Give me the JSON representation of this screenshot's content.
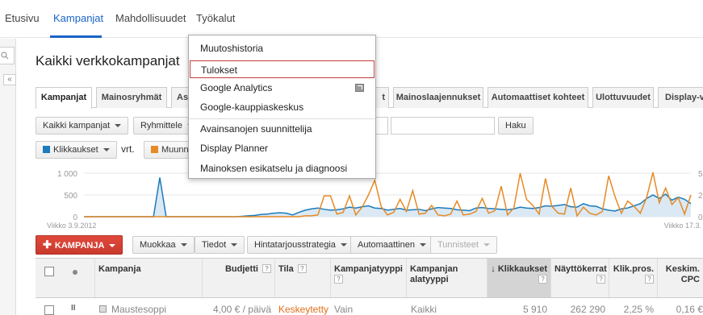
{
  "topnav": {
    "items": [
      "Etusivu",
      "Kampanjat",
      "Mahdollisuudet",
      "Työkalut"
    ]
  },
  "sidebar": {
    "collapse_glyph": "«"
  },
  "page": {
    "title": "Kaikki verkkokampanjat"
  },
  "tabs": [
    "Kampanjat",
    "Mainosryhmät",
    "As",
    "t",
    "Mainoslaajennukset",
    "Automaattiset kohteet",
    "Ulottuvuudet",
    "Display-ve"
  ],
  "filters": {
    "all_campaigns": "Kaikki kampanjat",
    "segment": "Ryhmittele",
    "search_button": "Haku"
  },
  "metrics": {
    "metric1": "Klikkaukset",
    "metric1_color": "#1a7bbd",
    "vs": "vrt.",
    "metric2": "Muunn",
    "metric2_color": "#e68a25"
  },
  "chart": {
    "y_left": [
      "1 000",
      "500",
      "0"
    ],
    "y_right": [
      "5",
      "2",
      "0"
    ],
    "date_start": "Viikko 3.9.2012",
    "date_end": "Viikko 17.3."
  },
  "chart_data": {
    "type": "line",
    "series": [
      {
        "name": "Klikkaukset",
        "values": [
          0,
          0,
          0,
          0,
          0,
          0,
          0,
          0,
          0,
          0,
          0,
          0,
          900,
          0,
          0,
          0,
          0,
          0,
          0,
          0,
          0,
          0,
          0,
          0,
          0,
          10,
          20,
          30,
          50,
          60,
          80,
          90,
          80,
          40,
          100,
          150,
          180,
          200,
          170,
          150,
          160,
          180,
          220,
          200,
          230,
          250,
          200,
          190,
          150,
          170,
          190,
          150,
          160,
          170,
          140,
          180,
          210,
          200,
          190,
          160,
          150,
          140,
          200,
          210,
          190,
          180,
          170,
          160,
          180,
          220,
          200,
          190,
          210,
          250,
          240,
          260,
          280,
          230,
          220,
          300,
          250,
          240,
          180,
          150,
          130,
          180,
          200,
          250,
          300,
          420,
          500,
          420,
          520,
          380,
          450,
          400,
          300
        ]
      },
      {
        "name": "Muunn",
        "values": [
          0,
          0,
          0,
          0,
          0,
          0,
          0,
          0,
          0,
          0,
          0,
          0,
          0,
          0,
          0,
          0,
          0,
          0,
          0,
          0,
          0,
          0,
          0,
          0,
          0,
          0,
          0,
          0,
          0,
          0,
          0,
          0,
          0,
          0,
          0,
          0.1,
          0.1,
          0.2,
          2.4,
          2.4,
          0.3,
          0.5,
          2.4,
          0.2,
          1.1,
          2.5,
          4.2,
          1.2,
          0.2,
          0.5,
          2.0,
          0.6,
          3.0,
          0.3,
          0.4,
          1.3,
          0.2,
          0.1,
          0.3,
          1.8,
          0.2,
          0.3,
          0.6,
          2.1,
          0.4,
          0.7,
          3.5,
          0.2,
          1.0,
          5.0,
          2.0,
          1.3,
          0.3,
          4.4,
          1.2,
          0.4,
          0.3,
          3.3,
          0.1,
          1.1,
          0.4,
          0.2,
          0.6,
          4.7,
          2.3,
          0.4,
          1.8,
          1.2,
          0.4,
          2.2,
          5.1,
          1.6,
          3.3,
          1.4,
          2.2,
          0.3,
          2.5
        ]
      }
    ]
  },
  "actions": {
    "campaign_button": "KAMPANJA",
    "edit": "Muokkaa",
    "details": "Tiedot",
    "bidstrategy": "Hintatarjousstrategia",
    "automate": "Automaattinen",
    "labels": "Tunnisteet"
  },
  "table": {
    "headers": {
      "campaign": "Kampanja",
      "budget": "Budjetti",
      "status": "Tila",
      "type": "Kampanjatyyppi",
      "subtype_1": "Kampanjan",
      "subtype_2": "alatyyppi",
      "clicks": "Klikkaukset",
      "impressions": "Näyttökerrat",
      "ctr": "Klik.pros.",
      "cpc_1": "Keskim.",
      "cpc_2": "CPC",
      "help": "?",
      "sort": "↓"
    },
    "row": {
      "pause": "II",
      "name": "Maustesoppi",
      "budget": "4,00 € / päivä",
      "status": "Keskeytetty",
      "type": "Vain",
      "subtype": "Kaikki",
      "clicks": "5 910",
      "impressions": "262 290",
      "ctr": "2,25 %",
      "cpc": "0,16 €"
    }
  },
  "dropdown": {
    "items": [
      "Muutoshistoria",
      "Tulokset",
      "Google Analytics",
      "Google-kauppiaskeskus",
      "Avainsanojen suunnittelija",
      "Display Planner",
      "Mainoksen esikatselu ja diagnoosi"
    ]
  }
}
